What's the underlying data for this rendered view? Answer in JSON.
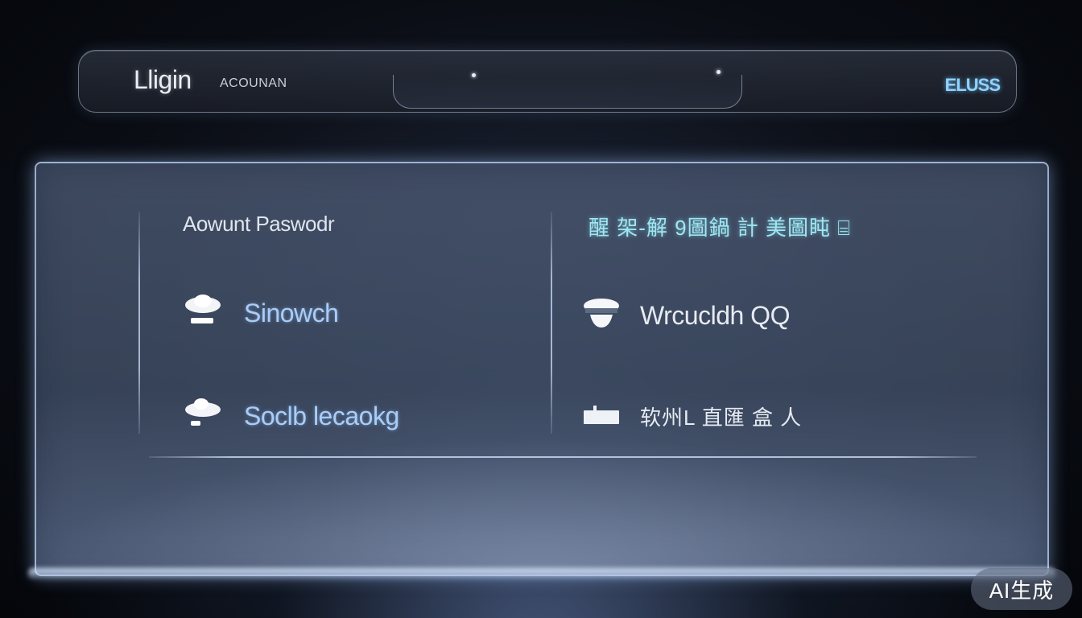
{
  "header": {
    "title": "Lligin",
    "subtitle": "ACOUNAN",
    "right_label": "ELUSS"
  },
  "panel": {
    "left_column": {
      "heading": "Aowunt Paswodr",
      "options": [
        {
          "label": "Sinowch",
          "icon": "cloud-user-icon"
        },
        {
          "label": "Soclb lecaokg",
          "icon": "cloud-user-icon"
        }
      ]
    },
    "right_column": {
      "heading": "醒 架-解 9圖鍋  計 美圖盹 ⌸",
      "options": [
        {
          "label": "Wrcucldh QQ",
          "icon": "chat-bubble-icon"
        },
        {
          "label": "软州L 直匯 盒 人",
          "icon": "card-icon"
        }
      ]
    }
  },
  "badge": {
    "label": "AI生成"
  },
  "colors": {
    "accent_cyan": "#9fe6f2",
    "accent_blue": "#a9cdf8",
    "panel_border": "#b9cdf0"
  }
}
